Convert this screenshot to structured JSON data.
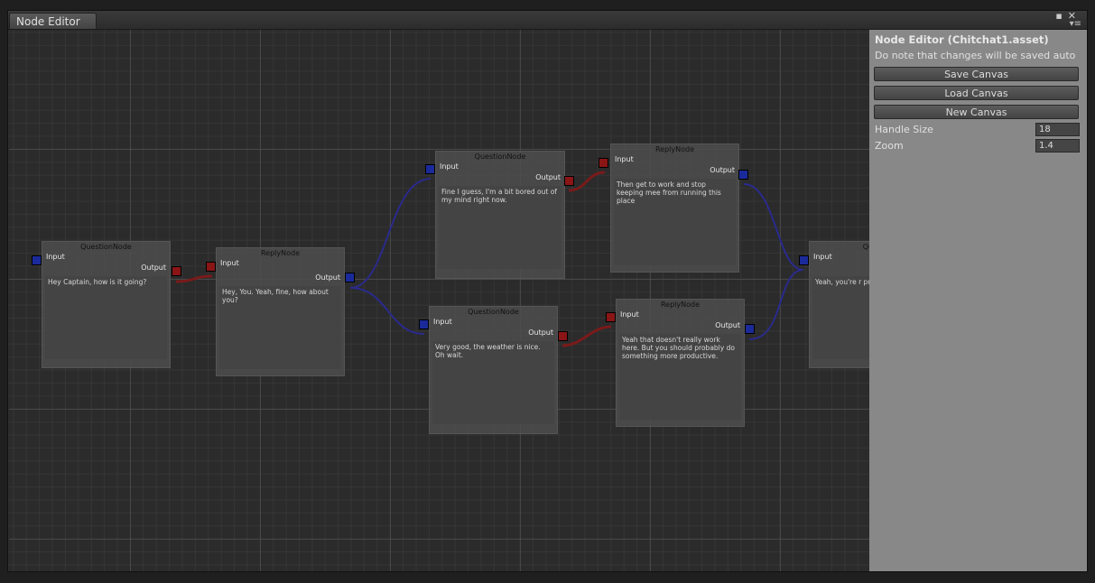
{
  "window": {
    "tab_title": "Node Editor"
  },
  "nodes": [
    {
      "title": "QuestionNode",
      "input_label": "Input",
      "output_label": "Output",
      "text": "Hey Captain, how is it going?"
    },
    {
      "title": "ReplyNode",
      "input_label": "Input",
      "output_label": "Output",
      "text": "Hey, You. Yeah, fine, how about you?"
    },
    {
      "title": "QuestionNode",
      "input_label": "Input",
      "output_label": "Output",
      "text": "Fine I guess, I'm a bit bored out of my mind right now."
    },
    {
      "title": "ReplyNode",
      "input_label": "Input",
      "output_label": "Output",
      "text": "Then get to work and stop keeping mee from running this place"
    },
    {
      "title": "QuestionNode",
      "input_label": "Input",
      "output_label": "Output",
      "text": "Very good, the weather is nice. Oh wait."
    },
    {
      "title": "ReplyNode",
      "input_label": "Input",
      "output_label": "Output",
      "text": "Yeah that doesn't really work here. But you should probably do something more productive."
    },
    {
      "title": "Quest",
      "input_label": "Input",
      "output_label": "",
      "text": "Yeah, you're r probably get go"
    }
  ],
  "panel": {
    "title": "Node Editor (Chitchat1.asset)",
    "note": "Do note that changes will be saved auto",
    "save_label": "Save Canvas",
    "load_label": "Load Canvas",
    "new_label": "New Canvas",
    "handle_size_label": "Handle Size",
    "handle_size_value": "18",
    "zoom_label": "Zoom",
    "zoom_value": "1.4"
  },
  "colors": {
    "input_knob": "#1a2a9a",
    "output_knob": "#8a1515",
    "reply_connection": "#2a2a8c",
    "question_connection": "#7a1a1a"
  }
}
